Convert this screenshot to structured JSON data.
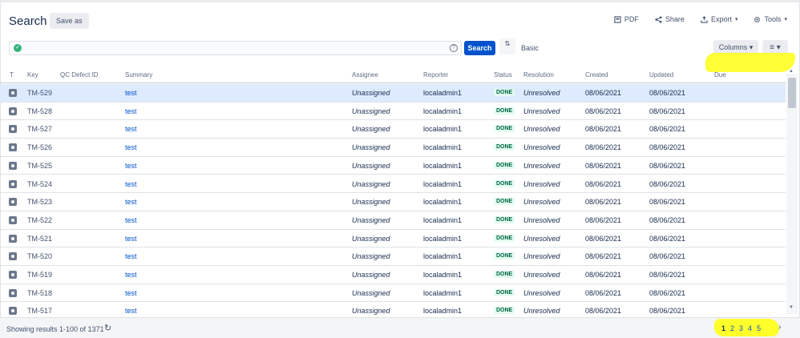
{
  "header": {
    "title": "Search",
    "save_as": "Save as",
    "pdf": "PDF",
    "share": "Share",
    "export": "Export",
    "tools": "Tools"
  },
  "query": {
    "value": "",
    "search_label": "Search",
    "basic_label": "Basic",
    "columns_label": "Columns",
    "menu_label": "≡"
  },
  "columns": [
    "T",
    "Key",
    "QC Defect ID",
    "Summary",
    "Assignee",
    "Reporter",
    "Status",
    "Resolution",
    "Created",
    "Updated",
    "Due"
  ],
  "rows": [
    {
      "key": "TM-529",
      "summary": "test",
      "assignee": "Unassigned",
      "reporter": "localadmin1",
      "status": "DONE",
      "resolution": "Unresolved",
      "created": "08/06/2021",
      "updated": "08/06/2021"
    },
    {
      "key": "TM-528",
      "summary": "test",
      "assignee": "Unassigned",
      "reporter": "localadmin1",
      "status": "DONE",
      "resolution": "Unresolved",
      "created": "08/06/2021",
      "updated": "08/06/2021"
    },
    {
      "key": "TM-527",
      "summary": "test",
      "assignee": "Unassigned",
      "reporter": "localadmin1",
      "status": "DONE",
      "resolution": "Unresolved",
      "created": "08/06/2021",
      "updated": "08/06/2021"
    },
    {
      "key": "TM-526",
      "summary": "test",
      "assignee": "Unassigned",
      "reporter": "localadmin1",
      "status": "DONE",
      "resolution": "Unresolved",
      "created": "08/06/2021",
      "updated": "08/06/2021"
    },
    {
      "key": "TM-525",
      "summary": "test",
      "assignee": "Unassigned",
      "reporter": "localadmin1",
      "status": "DONE",
      "resolution": "Unresolved",
      "created": "08/06/2021",
      "updated": "08/06/2021"
    },
    {
      "key": "TM-524",
      "summary": "test",
      "assignee": "Unassigned",
      "reporter": "localadmin1",
      "status": "DONE",
      "resolution": "Unresolved",
      "created": "08/06/2021",
      "updated": "08/06/2021"
    },
    {
      "key": "TM-523",
      "summary": "test",
      "assignee": "Unassigned",
      "reporter": "localadmin1",
      "status": "DONE",
      "resolution": "Unresolved",
      "created": "08/06/2021",
      "updated": "08/06/2021"
    },
    {
      "key": "TM-522",
      "summary": "test",
      "assignee": "Unassigned",
      "reporter": "localadmin1",
      "status": "DONE",
      "resolution": "Unresolved",
      "created": "08/06/2021",
      "updated": "08/06/2021"
    },
    {
      "key": "TM-521",
      "summary": "test",
      "assignee": "Unassigned",
      "reporter": "localadmin1",
      "status": "DONE",
      "resolution": "Unresolved",
      "created": "08/06/2021",
      "updated": "08/06/2021"
    },
    {
      "key": "TM-520",
      "summary": "test",
      "assignee": "Unassigned",
      "reporter": "localadmin1",
      "status": "DONE",
      "resolution": "Unresolved",
      "created": "08/06/2021",
      "updated": "08/06/2021"
    },
    {
      "key": "TM-519",
      "summary": "test",
      "assignee": "Unassigned",
      "reporter": "localadmin1",
      "status": "DONE",
      "resolution": "Unresolved",
      "created": "08/06/2021",
      "updated": "08/06/2021"
    },
    {
      "key": "TM-518",
      "summary": "test",
      "assignee": "Unassigned",
      "reporter": "localadmin1",
      "status": "DONE",
      "resolution": "Unresolved",
      "created": "08/06/2021",
      "updated": "08/06/2021"
    },
    {
      "key": "TM-517",
      "summary": "test",
      "assignee": "Unassigned",
      "reporter": "localadmin1",
      "status": "DONE",
      "resolution": "Unresolved",
      "created": "08/06/2021",
      "updated": "08/06/2021"
    }
  ],
  "footer": {
    "showing": "Showing results 1-100 of 1371",
    "pages": [
      "1",
      "2",
      "3",
      "4",
      "5"
    ],
    "current_page": "1"
  },
  "colors": {
    "accent": "#0052cc",
    "highlight": "#ffff2a",
    "done_green": "#006644",
    "selected_row": "#deebff"
  }
}
